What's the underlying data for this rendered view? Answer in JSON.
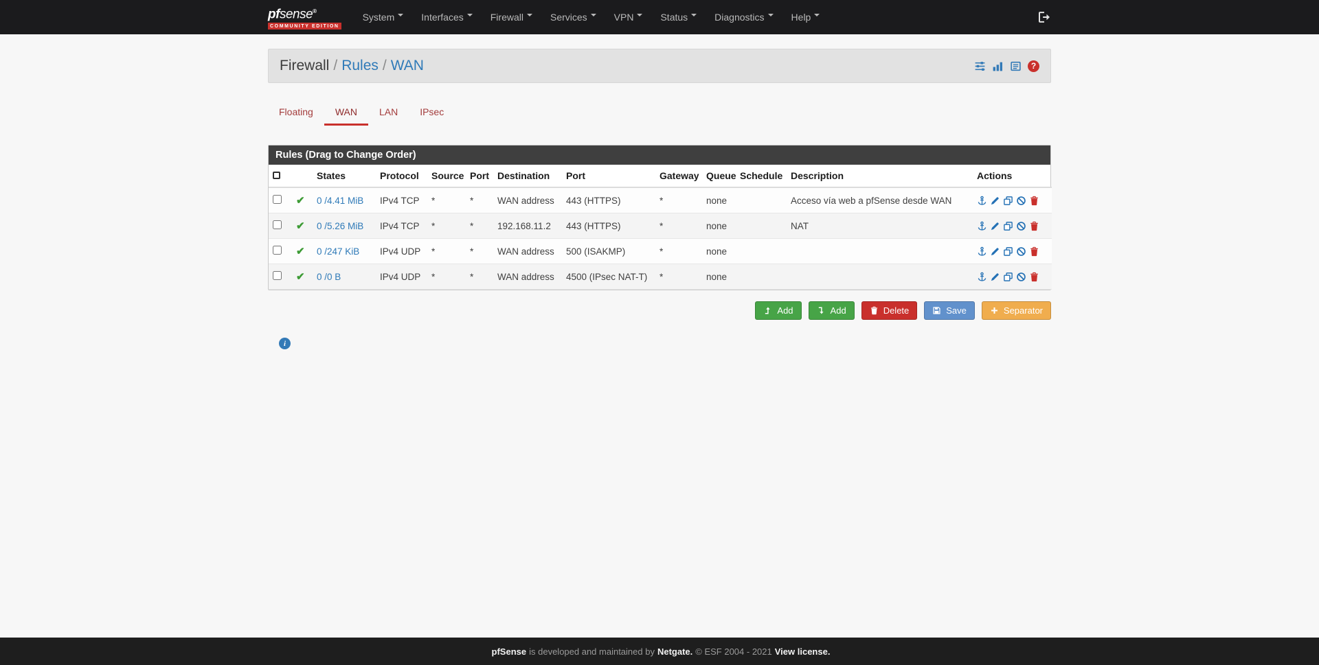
{
  "colors": {
    "navbar_bg": "#1b1b1d",
    "brand_red": "#c9302c",
    "link_blue": "#2f7ab8",
    "success_green": "#47a447",
    "warning_orange": "#f0ad4e",
    "save_blue": "#6191cc",
    "pass_green": "#3d9b35",
    "panel_header_bg": "#3f3f3f"
  },
  "icons": {
    "check": "✔",
    "question": "?",
    "info": "i"
  },
  "navbar": {
    "logo": {
      "pf": "pf",
      "sense": "sense",
      "reg": "®",
      "edition": "COMMUNITY EDITION"
    },
    "items": [
      "System",
      "Interfaces",
      "Firewall",
      "Services",
      "VPN",
      "Status",
      "Diagnostics",
      "Help"
    ]
  },
  "breadcrumb": {
    "section": "Firewall",
    "separator": "/",
    "link1": "Rules",
    "link2": "WAN"
  },
  "tabs": [
    {
      "label": "Floating",
      "active": false
    },
    {
      "label": "WAN",
      "active": true
    },
    {
      "label": "LAN",
      "active": false
    },
    {
      "label": "IPsec",
      "active": false
    }
  ],
  "panel": {
    "title": "Rules (Drag to Change Order)"
  },
  "table": {
    "headers": {
      "states": "States",
      "protocol": "Protocol",
      "source": "Source",
      "source_port": "Port",
      "destination": "Destination",
      "dest_port": "Port",
      "gateway": "Gateway",
      "queue": "Queue",
      "schedule": "Schedule",
      "description": "Description",
      "actions": "Actions"
    },
    "rows": [
      {
        "states": "0 /4.41 MiB",
        "protocol": "IPv4 TCP",
        "source": "*",
        "source_port": "*",
        "destination": "WAN address",
        "dest_port": "443 (HTTPS)",
        "gateway": "*",
        "queue": "none",
        "schedule": "",
        "description": "Acceso vía web a pfSense desde WAN"
      },
      {
        "states": "0 /5.26 MiB",
        "protocol": "IPv4 TCP",
        "source": "*",
        "source_port": "*",
        "destination": "192.168.11.2",
        "dest_port": "443 (HTTPS)",
        "gateway": "*",
        "queue": "none",
        "schedule": "",
        "description": "NAT"
      },
      {
        "states": "0 /247 KiB",
        "protocol": "IPv4 UDP",
        "source": "*",
        "source_port": "*",
        "destination": "WAN address",
        "dest_port": "500 (ISAKMP)",
        "gateway": "*",
        "queue": "none",
        "schedule": "",
        "description": ""
      },
      {
        "states": "0 /0 B",
        "protocol": "IPv4 UDP",
        "source": "*",
        "source_port": "*",
        "destination": "WAN address",
        "dest_port": "4500 (IPsec NAT-T)",
        "gateway": "*",
        "queue": "none",
        "schedule": "",
        "description": ""
      }
    ]
  },
  "buttons": {
    "add_top": "Add",
    "add_bottom": "Add",
    "delete": "Delete",
    "save": "Save",
    "separator": "Separator"
  },
  "footer": {
    "brand": "pfSense",
    "text": "is developed and maintained by",
    "company": "Netgate.",
    "copyright": "© ESF 2004 - 2021",
    "license": "View license."
  }
}
